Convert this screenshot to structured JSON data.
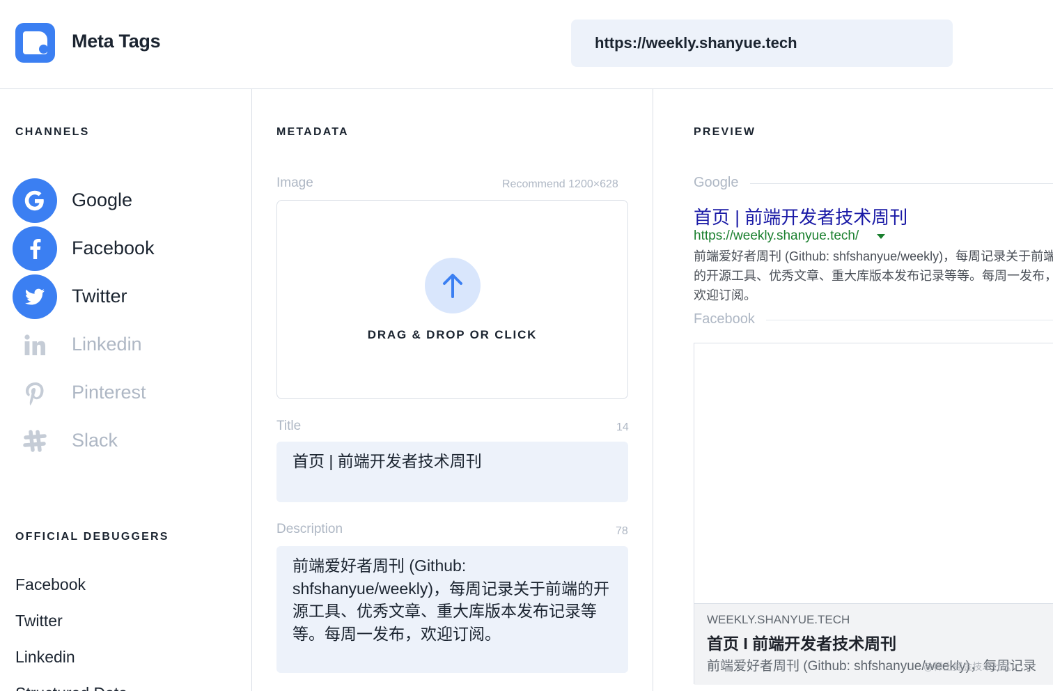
{
  "header": {
    "brand": "Meta Tags",
    "url_value": "https://weekly.shanyue.tech"
  },
  "channels": {
    "heading": "CHANNELS",
    "items": [
      {
        "label": "Google",
        "icon": "google-icon",
        "active": true
      },
      {
        "label": "Facebook",
        "icon": "facebook-icon",
        "active": true
      },
      {
        "label": "Twitter",
        "icon": "twitter-icon",
        "active": true
      },
      {
        "label": "Linkedin",
        "icon": "linkedin-icon",
        "active": false
      },
      {
        "label": "Pinterest",
        "icon": "pinterest-icon",
        "active": false
      },
      {
        "label": "Slack",
        "icon": "slack-icon",
        "active": false
      }
    ]
  },
  "debuggers": {
    "heading": "OFFICIAL DEBUGGERS",
    "items": [
      "Facebook",
      "Twitter",
      "Linkedin",
      "Structured Data"
    ]
  },
  "metadata": {
    "heading": "METADATA",
    "image_label": "Image",
    "image_hint": "Recommend 1200×628",
    "drop_text": "DRAG & DROP OR CLICK",
    "title_label": "Title",
    "title_count": "14",
    "title_value": "首页 | 前端开发者技术周刊",
    "description_label": "Description",
    "description_count": "78",
    "description_value": "前端爱好者周刊 (Github: shfshanyue/weekly)，每周记录关于前端的开源工具、优秀文章、重大库版本发布记录等等。每周一发布，欢迎订阅。"
  },
  "preview": {
    "heading": "PREVIEW",
    "google_label": "Google",
    "google_title": "首页 | 前端开发者技术周刊",
    "google_url": "https://weekly.shanyue.tech/",
    "google_desc": "前端爱好者周刊 (Github: shfshanyue/weekly)，每周记录关于前端的开源工具、优秀文章、重大库版本发布记录等等。每周一发布，欢迎订阅。",
    "facebook_label": "Facebook",
    "fb_domain": "WEEKLY.SHANYUE.TECH",
    "fb_title": "首页 I 前端开发者技术周刊",
    "fb_desc": "前端爱好者周刊 (Github: shfshanyue/weekly)，每周记录",
    "watermark": "@稀土掘金技术社区"
  },
  "colors": {
    "accent": "#3b7ff2",
    "input_bg": "#edf2fa",
    "muted": "#aeb7c4",
    "google_link": "#1a1aa6",
    "google_url": "#1a7f2e"
  }
}
